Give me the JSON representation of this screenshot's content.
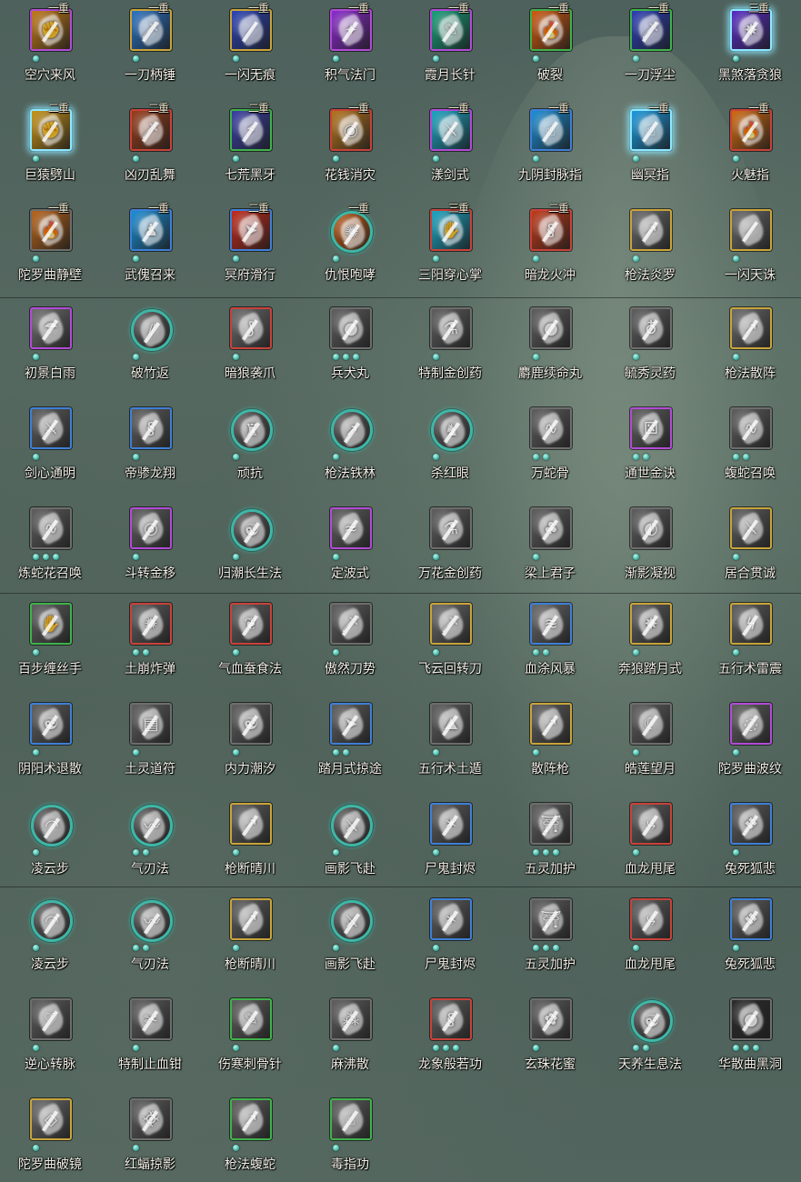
{
  "colors": {
    "frame_purple": "#b24bd6",
    "frame_gold": "#c9a43a",
    "frame_green": "#3fb24a",
    "frame_red": "#c8423a",
    "frame_blue": "#3f7fd6",
    "frame_teal": "#3fb6a6",
    "frame_gray": "#6d6d6d",
    "label_text": "#f2efe6",
    "rank_text": "#f1ead2",
    "pip": "#3fb6a6"
  },
  "skills": [
    {
      "name": "空穴来风",
      "rank": "一重",
      "frame": "purple",
      "shape": "square",
      "pips": 1,
      "art": "#c27a18",
      "icon": "fist-icon"
    },
    {
      "name": "一刀柄锤",
      "rank": "一重",
      "frame": "gold",
      "shape": "square",
      "pips": 1,
      "art": "#2a73c4",
      "icon": "blade-icon"
    },
    {
      "name": "一闪无痕",
      "rank": "一重",
      "frame": "gold",
      "shape": "square",
      "pips": 1,
      "art": "#2b44b8",
      "icon": "slash-icon"
    },
    {
      "name": "积气法门",
      "rank": "一重",
      "frame": "purple",
      "shape": "square",
      "pips": 1,
      "art": "#8c2ad0",
      "icon": "spark-icon"
    },
    {
      "name": "霞月长针",
      "rank": "一重",
      "frame": "purple",
      "shape": "square",
      "pips": 1,
      "art": "#17a07a",
      "icon": "needle-icon"
    },
    {
      "name": "破裂",
      "rank": "一重",
      "frame": "green",
      "shape": "square",
      "pips": 1,
      "art": "#d25a10",
      "icon": "flame-icon"
    },
    {
      "name": "一刀浮尘",
      "rank": "一重",
      "frame": "green",
      "shape": "square",
      "pips": 1,
      "art": "#2c3fb8",
      "icon": "blade-icon"
    },
    {
      "name": "黑煞落贪狼",
      "rank": "三重",
      "frame": "glow",
      "shape": "square",
      "pips": 1,
      "art": "#5a2cc8",
      "icon": "wolf-icon"
    },
    {
      "name": "巨猿劈山",
      "rank": "二重",
      "frame": "glow",
      "shape": "square",
      "pips": 1,
      "art": "#c99418",
      "icon": "ape-icon"
    },
    {
      "name": "凶刃乱舞",
      "rank": "二重",
      "frame": "red",
      "shape": "square",
      "pips": 1,
      "art": "#9a3d1a",
      "icon": "blade-icon"
    },
    {
      "name": "七荒黑牙",
      "rank": "二重",
      "frame": "green",
      "shape": "square",
      "pips": 1,
      "art": "#3b3fa6",
      "icon": "fang-icon"
    },
    {
      "name": "花钱消灾",
      "rank": "一重",
      "frame": "red",
      "shape": "square",
      "pips": 1,
      "art": "#b6741c",
      "icon": "coin-icon"
    },
    {
      "name": "漾剑式",
      "rank": "一重",
      "frame": "purple",
      "shape": "square",
      "pips": 1,
      "art": "#1aa6c4",
      "icon": "sword-icon"
    },
    {
      "name": "九阴封脉指",
      "rank": "一重",
      "frame": "blue",
      "shape": "square",
      "pips": 1,
      "art": "#1a8ed6",
      "icon": "finger-icon"
    },
    {
      "name": "幽冥指",
      "rank": "一重",
      "frame": "glow",
      "shape": "square",
      "pips": 1,
      "art": "#1a9ae0",
      "icon": "finger-icon"
    },
    {
      "name": "火魅指",
      "rank": "一重",
      "frame": "red",
      "shape": "square",
      "pips": 1,
      "art": "#d26a10",
      "icon": "flame-icon"
    },
    {
      "name": "陀罗曲静壁",
      "rank": "一重",
      "frame": "gray",
      "shape": "square",
      "pips": 1,
      "art": "#b8641a",
      "icon": "flame-icon"
    },
    {
      "name": "武傀召来",
      "rank": "一重",
      "frame": "blue",
      "shape": "square",
      "pips": 1,
      "art": "#1a8ed6",
      "icon": "puppet-icon"
    },
    {
      "name": "冥府滑行",
      "rank": "二重",
      "frame": "blue",
      "shape": "square",
      "pips": 1,
      "art": "#c42a1a",
      "icon": "dash-icon"
    },
    {
      "name": "仇恨咆哮",
      "rank": "一重",
      "frame": "teal",
      "shape": "round",
      "pips": 1,
      "art": "#c25a18",
      "icon": "roar-icon"
    },
    {
      "name": "三阳穿心掌",
      "rank": "三重",
      "frame": "red",
      "shape": "square",
      "pips": 1,
      "art": "#1aa6c4",
      "icon": "palm-icon"
    },
    {
      "name": "暗龙火冲",
      "rank": "二重",
      "frame": "red",
      "shape": "square",
      "pips": 1,
      "art": "#c23a18",
      "icon": "dragon-icon"
    },
    {
      "name": "枪法炎罗",
      "rank": "",
      "frame": "gold",
      "shape": "square",
      "pips": 1,
      "art": "#6a6a6a",
      "icon": "spear-icon"
    },
    {
      "name": "一闪天诛",
      "rank": "",
      "frame": "gold",
      "shape": "square",
      "pips": 1,
      "art": "#6a6a6a",
      "icon": "slash-icon"
    },
    {
      "name": "初景白雨",
      "rank": "",
      "frame": "purple",
      "shape": "square",
      "pips": 1,
      "art": "#6f6f6f",
      "icon": "rain-icon"
    },
    {
      "name": "破竹返",
      "rank": "",
      "frame": "teal",
      "shape": "round",
      "pips": 1,
      "art": "#5c5c5c",
      "icon": "bamboo-icon"
    },
    {
      "name": "暗狼袭爪",
      "rank": "",
      "frame": "red",
      "shape": "square",
      "pips": 1,
      "art": "#6a6a6a",
      "icon": "claw-icon"
    },
    {
      "name": "兵犬丸",
      "rank": "",
      "frame": "gray",
      "shape": "square",
      "pips": 3,
      "art": "#5f5f5f",
      "icon": "pill-icon"
    },
    {
      "name": "特制金创药",
      "rank": "",
      "frame": "gray",
      "shape": "square",
      "pips": 1,
      "art": "#5f5f5f",
      "icon": "potion-icon"
    },
    {
      "name": "麝鹿续命丸",
      "rank": "",
      "frame": "gray",
      "shape": "square",
      "pips": 1,
      "art": "#5f5f5f",
      "icon": "pill-icon"
    },
    {
      "name": "毓秀灵药",
      "rank": "",
      "frame": "gray",
      "shape": "square",
      "pips": 1,
      "art": "#5f5f5f",
      "icon": "gourd-icon"
    },
    {
      "name": "枪法散阵",
      "rank": "",
      "frame": "gold",
      "shape": "square",
      "pips": 1,
      "art": "#6a6a6a",
      "icon": "spear-icon"
    },
    {
      "name": "剑心通明",
      "rank": "",
      "frame": "blue",
      "shape": "square",
      "pips": 1,
      "art": "#5f5f5f",
      "icon": "sword-icon"
    },
    {
      "name": "帝骖龙翔",
      "rank": "",
      "frame": "blue",
      "shape": "square",
      "pips": 1,
      "art": "#5f5f5f",
      "icon": "dragon-icon"
    },
    {
      "name": "顽抗",
      "rank": "",
      "frame": "teal",
      "shape": "round",
      "pips": 1,
      "art": "#5c5c5c",
      "icon": "warrior-icon"
    },
    {
      "name": "枪法铁林",
      "rank": "",
      "frame": "teal",
      "shape": "round",
      "pips": 1,
      "art": "#5c5c5c",
      "icon": "spear-icon"
    },
    {
      "name": "杀红眼",
      "rank": "",
      "frame": "teal",
      "shape": "round",
      "pips": 1,
      "art": "#5c5c5c",
      "icon": "helmet-icon"
    },
    {
      "name": "万蛇骨",
      "rank": "",
      "frame": "gray",
      "shape": "square",
      "pips": 2,
      "art": "#5f5f5f",
      "icon": "snake-icon"
    },
    {
      "name": "通世金诀",
      "rank": "",
      "frame": "purple",
      "shape": "square",
      "pips": 2,
      "art": "#5f5f5f",
      "icon": "dice-icon"
    },
    {
      "name": "蝮蛇召唤",
      "rank": "",
      "frame": "gray",
      "shape": "square",
      "pips": 2,
      "art": "#5f5f5f",
      "icon": "snake-icon"
    },
    {
      "name": "炼蛇花召唤",
      "rank": "",
      "frame": "gray",
      "shape": "square",
      "pips": 3,
      "art": "#5f5f5f",
      "icon": "snake-icon"
    },
    {
      "name": "斗转金移",
      "rank": "",
      "frame": "purple",
      "shape": "square",
      "pips": 1,
      "art": "#5f5f5f",
      "icon": "swirl-icon"
    },
    {
      "name": "归潮长生法",
      "rank": "",
      "frame": "teal",
      "shape": "round",
      "pips": 1,
      "art": "#5c5c5c",
      "icon": "meditate-icon"
    },
    {
      "name": "定波式",
      "rank": "",
      "frame": "purple",
      "shape": "square",
      "pips": 1,
      "art": "#5f5f5f",
      "icon": "wave-icon"
    },
    {
      "name": "万花金创药",
      "rank": "",
      "frame": "gray",
      "shape": "square",
      "pips": 1,
      "art": "#5f5f5f",
      "icon": "potion-icon"
    },
    {
      "name": "梁上君子",
      "rank": "",
      "frame": "gray",
      "shape": "square",
      "pips": 1,
      "art": "#5f5f5f",
      "icon": "thief-icon"
    },
    {
      "name": "渐影凝视",
      "rank": "",
      "frame": "gray",
      "shape": "square",
      "pips": 1,
      "art": "#5f5f5f",
      "icon": "gaze-icon"
    },
    {
      "name": "居合贯诚",
      "rank": "",
      "frame": "gold",
      "shape": "square",
      "pips": 1,
      "art": "#5f5f5f",
      "icon": "sword-icon"
    },
    {
      "name": "百步缠丝手",
      "rank": "",
      "frame": "green",
      "shape": "square",
      "pips": 1,
      "art": "#5f5f5f",
      "icon": "hand-icon"
    },
    {
      "name": "土崩炸弹",
      "rank": "",
      "frame": "red",
      "shape": "square",
      "pips": 2,
      "art": "#5f5f5f",
      "icon": "bomb-icon"
    },
    {
      "name": "气血蚕食法",
      "rank": "",
      "frame": "red",
      "shape": "square",
      "pips": 1,
      "art": "#5f5f5f",
      "icon": "blood-icon"
    },
    {
      "name": "傲然刀势",
      "rank": "",
      "frame": "gray",
      "shape": "square",
      "pips": 1,
      "art": "#5f5f5f",
      "icon": "blade-icon"
    },
    {
      "name": "飞云回转刀",
      "rank": "",
      "frame": "gold",
      "shape": "square",
      "pips": 1,
      "art": "#6a6a6a",
      "icon": "blade-icon"
    },
    {
      "name": "血涂风暴",
      "rank": "",
      "frame": "blue",
      "shape": "square",
      "pips": 2,
      "art": "#6a6a6a",
      "icon": "storm-icon"
    },
    {
      "name": "奔狼踏月式",
      "rank": "",
      "frame": "gold",
      "shape": "square",
      "pips": 1,
      "art": "#5f5f5f",
      "icon": "wolf-icon"
    },
    {
      "name": "五行术雷震",
      "rank": "",
      "frame": "gold",
      "shape": "square",
      "pips": 1,
      "art": "#5f5f5f",
      "icon": "thunder-icon"
    },
    {
      "name": "阴阳术退散",
      "rank": "",
      "frame": "blue",
      "shape": "square",
      "pips": 1,
      "art": "#5f5f5f",
      "icon": "yinyang-icon"
    },
    {
      "name": "土灵道符",
      "rank": "",
      "frame": "gray",
      "shape": "square",
      "pips": 1,
      "art": "#5f5f5f",
      "icon": "talisman-icon"
    },
    {
      "name": "内力潮汐",
      "rank": "",
      "frame": "gray",
      "shape": "square",
      "pips": 1,
      "art": "#5f5f5f",
      "icon": "meditate-icon"
    },
    {
      "name": "踏月式掠途",
      "rank": "",
      "frame": "blue",
      "shape": "square",
      "pips": 2,
      "art": "#5f5f5f",
      "icon": "dash-icon"
    },
    {
      "name": "五行术土遁",
      "rank": "",
      "frame": "gray",
      "shape": "square",
      "pips": 1,
      "art": "#5f5f5f",
      "icon": "earth-icon"
    },
    {
      "name": "散阵枪",
      "rank": "",
      "frame": "gold",
      "shape": "square",
      "pips": 1,
      "art": "#5f5f5f",
      "icon": "spear-icon"
    },
    {
      "name": "皓莲望月",
      "rank": "",
      "frame": "gray",
      "shape": "square",
      "pips": 1,
      "art": "#5f5f5f",
      "icon": "moon-icon"
    },
    {
      "name": "陀罗曲波纹",
      "rank": "",
      "frame": "purple",
      "shape": "square",
      "pips": 1,
      "art": "#5f5f5f",
      "icon": "ripple-icon"
    },
    {
      "name": "凌云步",
      "rank": "",
      "frame": "teal",
      "shape": "round",
      "pips": 1,
      "art": "#5c5c5c",
      "icon": "step-icon"
    },
    {
      "name": "气刃法",
      "rank": "",
      "frame": "teal",
      "shape": "round",
      "pips": 2,
      "art": "#5c5c5c",
      "icon": "wind-blade-icon"
    },
    {
      "name": "枪断晴川",
      "rank": "",
      "frame": "gold",
      "shape": "square",
      "pips": 1,
      "art": "#5f5f5f",
      "icon": "spear-icon"
    },
    {
      "name": "画影飞赴",
      "rank": "",
      "frame": "teal",
      "shape": "round",
      "pips": 1,
      "art": "#5c5c5c",
      "icon": "sword-icon"
    },
    {
      "name": "尸鬼封烬",
      "rank": "",
      "frame": "blue",
      "shape": "square",
      "pips": 1,
      "art": "#5f5f5f",
      "icon": "fire-orb-icon"
    },
    {
      "name": "五灵加护",
      "rank": "",
      "frame": "gray",
      "shape": "square",
      "pips": 3,
      "art": "#5f5f5f",
      "icon": "shrine-icon"
    },
    {
      "name": "血龙甩尾",
      "rank": "",
      "frame": "red",
      "shape": "square",
      "pips": 1,
      "art": "#5f5f5f",
      "icon": "tail-icon"
    },
    {
      "name": "兔死狐悲",
      "rank": "",
      "frame": "blue",
      "shape": "square",
      "pips": 1,
      "art": "#5f5f5f",
      "icon": "fox-icon"
    },
    {
      "name": "凌云步",
      "rank": "",
      "frame": "teal",
      "shape": "round",
      "pips": 1,
      "art": "#5c5c5c",
      "icon": "step-icon"
    },
    {
      "name": "气刃法",
      "rank": "",
      "frame": "teal",
      "shape": "round",
      "pips": 2,
      "art": "#5c5c5c",
      "icon": "wind-blade-icon"
    },
    {
      "name": "枪断晴川",
      "rank": "",
      "frame": "gold",
      "shape": "square",
      "pips": 1,
      "art": "#5f5f5f",
      "icon": "spear-icon"
    },
    {
      "name": "画影飞赴",
      "rank": "",
      "frame": "teal",
      "shape": "round",
      "pips": 1,
      "art": "#5c5c5c",
      "icon": "sword-icon"
    },
    {
      "name": "尸鬼封烬",
      "rank": "",
      "frame": "blue",
      "shape": "square",
      "pips": 1,
      "art": "#5f5f5f",
      "icon": "fire-orb-icon"
    },
    {
      "name": "五灵加护",
      "rank": "",
      "frame": "gray",
      "shape": "square",
      "pips": 3,
      "art": "#5f5f5f",
      "icon": "shrine-icon"
    },
    {
      "name": "血龙甩尾",
      "rank": "",
      "frame": "red",
      "shape": "square",
      "pips": 1,
      "art": "#5f5f5f",
      "icon": "tail-icon"
    },
    {
      "name": "兔死狐悲",
      "rank": "",
      "frame": "blue",
      "shape": "square",
      "pips": 1,
      "art": "#5f5f5f",
      "icon": "fox-icon"
    },
    {
      "name": "逆心转脉",
      "rank": "",
      "frame": "gray",
      "shape": "square",
      "pips": 1,
      "art": "#5f5f5f",
      "icon": "pulse-icon"
    },
    {
      "name": "特制止血钳",
      "rank": "",
      "frame": "gray",
      "shape": "square",
      "pips": 1,
      "art": "#5f5f5f",
      "icon": "pliers-icon"
    },
    {
      "name": "伤寒刺骨针",
      "rank": "",
      "frame": "green",
      "shape": "square",
      "pips": 1,
      "art": "#5f5f5f",
      "icon": "needle-icon"
    },
    {
      "name": "麻沸散",
      "rank": "",
      "frame": "gray",
      "shape": "square",
      "pips": 1,
      "art": "#5f5f5f",
      "icon": "powder-icon"
    },
    {
      "name": "龙象般若功",
      "rank": "",
      "frame": "red",
      "shape": "square",
      "pips": 3,
      "art": "#5f5f5f",
      "icon": "dragon-icon"
    },
    {
      "name": "玄珠花蜜",
      "rank": "",
      "frame": "gray",
      "shape": "square",
      "pips": 1,
      "art": "#5f5f5f",
      "icon": "honey-icon"
    },
    {
      "name": "天养生息法",
      "rank": "",
      "frame": "teal",
      "shape": "round",
      "pips": 2,
      "art": "#5c5c5c",
      "icon": "meditate-icon"
    },
    {
      "name": "华散曲黑洞",
      "rank": "",
      "frame": "gray",
      "shape": "square",
      "pips": 3,
      "art": "#2c2c2c",
      "icon": "blackhole-icon"
    },
    {
      "name": "陀罗曲破镜",
      "rank": "",
      "frame": "gold",
      "shape": "square",
      "pips": 1,
      "art": "#6a6a6a",
      "icon": "mirror-icon"
    },
    {
      "name": "红蝠掠影",
      "rank": "",
      "frame": "gray",
      "shape": "square",
      "pips": 1,
      "art": "#5f5f5f",
      "icon": "bat-icon"
    },
    {
      "name": "枪法蝮蛇",
      "rank": "",
      "frame": "green",
      "shape": "square",
      "pips": 1,
      "art": "#5f5f5f",
      "icon": "spear-icon"
    },
    {
      "name": "毒指功",
      "rank": "",
      "frame": "green",
      "shape": "square",
      "pips": 1,
      "art": "#5f5f5f",
      "icon": "finger-icon"
    }
  ]
}
